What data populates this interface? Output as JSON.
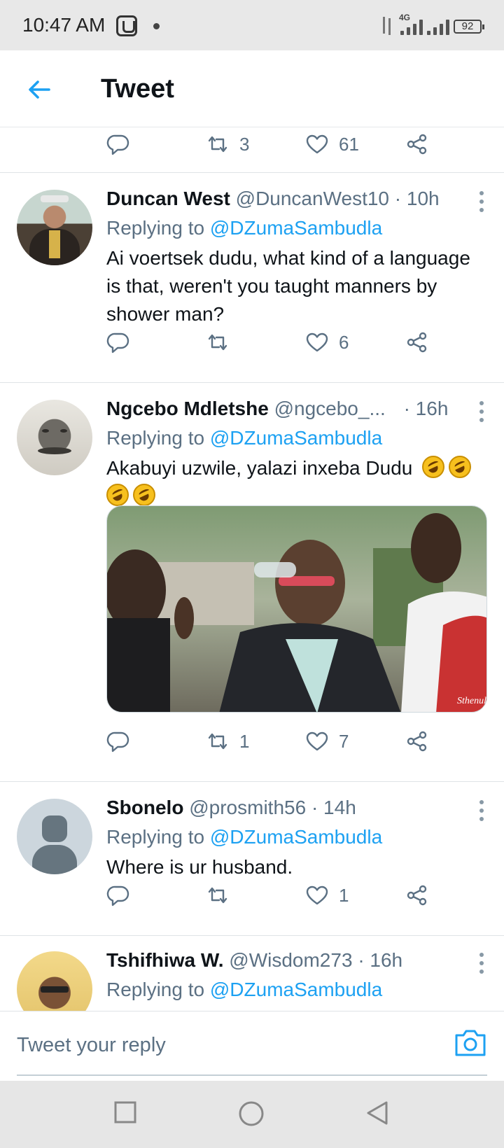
{
  "status_bar": {
    "time": "10:47 AM",
    "network": "4G",
    "battery": "92",
    "icons": [
      "app-notification-icon",
      "dot-icon",
      "data-arrows-icon",
      "signal-icon",
      "signal-icon",
      "battery-icon"
    ]
  },
  "header": {
    "title": "Tweet",
    "back_icon": "back-arrow-icon"
  },
  "top_actions": {
    "retweets": "3",
    "likes": "61"
  },
  "tweets": [
    {
      "name": "Duncan West",
      "handle": "@DuncanWest10",
      "time": "· 10h",
      "replying_prefix": "Replying to",
      "replying_to": "@DZumaSambudla",
      "text": "Ai voertsek dudu, what kind of a language is that, weren't you taught manners by shower man?",
      "retweets": "",
      "likes": "6"
    },
    {
      "name": "Ngcebo Mdletshe",
      "handle": "@ngcebo_...",
      "time": "· 16h",
      "replying_prefix": "Replying to",
      "replying_to": "@DZumaSambudla",
      "text": "Akabuyi uzwile, yalazi inxeba Dudu",
      "emoji": "rolling-on-floor-laughing",
      "emoji_count": 4,
      "media_watermark": "Sthenule",
      "retweets": "1",
      "likes": "7"
    },
    {
      "name": "Sbonelo",
      "handle": "@prosmith56",
      "time": "· 14h",
      "replying_prefix": "Replying to",
      "replying_to": "@DZumaSambudla",
      "text": "Where is ur husband.",
      "retweets": "",
      "likes": "1"
    },
    {
      "name": "Tshifhiwa W.",
      "handle": "@Wisdom273",
      "time": "· 16h",
      "replying_prefix": "Replying to",
      "replying_to": "@DZumaSambudla"
    }
  ],
  "reply_bar": {
    "placeholder": "Tweet your reply",
    "camera_icon": "camera-icon"
  },
  "nav_bar": {
    "icons": [
      "recents-square-icon",
      "home-circle-icon",
      "back-triangle-icon"
    ]
  },
  "colors": {
    "accent": "#1da1f2",
    "secondary_text": "#5b7083",
    "primary_text": "#0f1419"
  }
}
